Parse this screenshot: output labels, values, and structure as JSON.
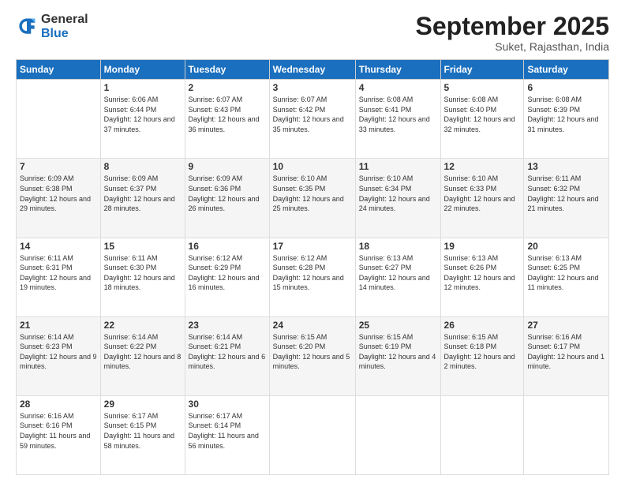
{
  "logo": {
    "general": "General",
    "blue": "Blue"
  },
  "title": "September 2025",
  "subtitle": "Suket, Rajasthan, India",
  "weekdays": [
    "Sunday",
    "Monday",
    "Tuesday",
    "Wednesday",
    "Thursday",
    "Friday",
    "Saturday"
  ],
  "rows": [
    [
      {
        "day": "",
        "sunrise": "",
        "sunset": "",
        "daylight": ""
      },
      {
        "day": "1",
        "sunrise": "Sunrise: 6:06 AM",
        "sunset": "Sunset: 6:44 PM",
        "daylight": "Daylight: 12 hours and 37 minutes."
      },
      {
        "day": "2",
        "sunrise": "Sunrise: 6:07 AM",
        "sunset": "Sunset: 6:43 PM",
        "daylight": "Daylight: 12 hours and 36 minutes."
      },
      {
        "day": "3",
        "sunrise": "Sunrise: 6:07 AM",
        "sunset": "Sunset: 6:42 PM",
        "daylight": "Daylight: 12 hours and 35 minutes."
      },
      {
        "day": "4",
        "sunrise": "Sunrise: 6:08 AM",
        "sunset": "Sunset: 6:41 PM",
        "daylight": "Daylight: 12 hours and 33 minutes."
      },
      {
        "day": "5",
        "sunrise": "Sunrise: 6:08 AM",
        "sunset": "Sunset: 6:40 PM",
        "daylight": "Daylight: 12 hours and 32 minutes."
      },
      {
        "day": "6",
        "sunrise": "Sunrise: 6:08 AM",
        "sunset": "Sunset: 6:39 PM",
        "daylight": "Daylight: 12 hours and 31 minutes."
      }
    ],
    [
      {
        "day": "7",
        "sunrise": "Sunrise: 6:09 AM",
        "sunset": "Sunset: 6:38 PM",
        "daylight": "Daylight: 12 hours and 29 minutes."
      },
      {
        "day": "8",
        "sunrise": "Sunrise: 6:09 AM",
        "sunset": "Sunset: 6:37 PM",
        "daylight": "Daylight: 12 hours and 28 minutes."
      },
      {
        "day": "9",
        "sunrise": "Sunrise: 6:09 AM",
        "sunset": "Sunset: 6:36 PM",
        "daylight": "Daylight: 12 hours and 26 minutes."
      },
      {
        "day": "10",
        "sunrise": "Sunrise: 6:10 AM",
        "sunset": "Sunset: 6:35 PM",
        "daylight": "Daylight: 12 hours and 25 minutes."
      },
      {
        "day": "11",
        "sunrise": "Sunrise: 6:10 AM",
        "sunset": "Sunset: 6:34 PM",
        "daylight": "Daylight: 12 hours and 24 minutes."
      },
      {
        "day": "12",
        "sunrise": "Sunrise: 6:10 AM",
        "sunset": "Sunset: 6:33 PM",
        "daylight": "Daylight: 12 hours and 22 minutes."
      },
      {
        "day": "13",
        "sunrise": "Sunrise: 6:11 AM",
        "sunset": "Sunset: 6:32 PM",
        "daylight": "Daylight: 12 hours and 21 minutes."
      }
    ],
    [
      {
        "day": "14",
        "sunrise": "Sunrise: 6:11 AM",
        "sunset": "Sunset: 6:31 PM",
        "daylight": "Daylight: 12 hours and 19 minutes."
      },
      {
        "day": "15",
        "sunrise": "Sunrise: 6:11 AM",
        "sunset": "Sunset: 6:30 PM",
        "daylight": "Daylight: 12 hours and 18 minutes."
      },
      {
        "day": "16",
        "sunrise": "Sunrise: 6:12 AM",
        "sunset": "Sunset: 6:29 PM",
        "daylight": "Daylight: 12 hours and 16 minutes."
      },
      {
        "day": "17",
        "sunrise": "Sunrise: 6:12 AM",
        "sunset": "Sunset: 6:28 PM",
        "daylight": "Daylight: 12 hours and 15 minutes."
      },
      {
        "day": "18",
        "sunrise": "Sunrise: 6:13 AM",
        "sunset": "Sunset: 6:27 PM",
        "daylight": "Daylight: 12 hours and 14 minutes."
      },
      {
        "day": "19",
        "sunrise": "Sunrise: 6:13 AM",
        "sunset": "Sunset: 6:26 PM",
        "daylight": "Daylight: 12 hours and 12 minutes."
      },
      {
        "day": "20",
        "sunrise": "Sunrise: 6:13 AM",
        "sunset": "Sunset: 6:25 PM",
        "daylight": "Daylight: 12 hours and 11 minutes."
      }
    ],
    [
      {
        "day": "21",
        "sunrise": "Sunrise: 6:14 AM",
        "sunset": "Sunset: 6:23 PM",
        "daylight": "Daylight: 12 hours and 9 minutes."
      },
      {
        "day": "22",
        "sunrise": "Sunrise: 6:14 AM",
        "sunset": "Sunset: 6:22 PM",
        "daylight": "Daylight: 12 hours and 8 minutes."
      },
      {
        "day": "23",
        "sunrise": "Sunrise: 6:14 AM",
        "sunset": "Sunset: 6:21 PM",
        "daylight": "Daylight: 12 hours and 6 minutes."
      },
      {
        "day": "24",
        "sunrise": "Sunrise: 6:15 AM",
        "sunset": "Sunset: 6:20 PM",
        "daylight": "Daylight: 12 hours and 5 minutes."
      },
      {
        "day": "25",
        "sunrise": "Sunrise: 6:15 AM",
        "sunset": "Sunset: 6:19 PM",
        "daylight": "Daylight: 12 hours and 4 minutes."
      },
      {
        "day": "26",
        "sunrise": "Sunrise: 6:15 AM",
        "sunset": "Sunset: 6:18 PM",
        "daylight": "Daylight: 12 hours and 2 minutes."
      },
      {
        "day": "27",
        "sunrise": "Sunrise: 6:16 AM",
        "sunset": "Sunset: 6:17 PM",
        "daylight": "Daylight: 12 hours and 1 minute."
      }
    ],
    [
      {
        "day": "28",
        "sunrise": "Sunrise: 6:16 AM",
        "sunset": "Sunset: 6:16 PM",
        "daylight": "Daylight: 11 hours and 59 minutes."
      },
      {
        "day": "29",
        "sunrise": "Sunrise: 6:17 AM",
        "sunset": "Sunset: 6:15 PM",
        "daylight": "Daylight: 11 hours and 58 minutes."
      },
      {
        "day": "30",
        "sunrise": "Sunrise: 6:17 AM",
        "sunset": "Sunset: 6:14 PM",
        "daylight": "Daylight: 11 hours and 56 minutes."
      },
      {
        "day": "",
        "sunrise": "",
        "sunset": "",
        "daylight": ""
      },
      {
        "day": "",
        "sunrise": "",
        "sunset": "",
        "daylight": ""
      },
      {
        "day": "",
        "sunrise": "",
        "sunset": "",
        "daylight": ""
      },
      {
        "day": "",
        "sunrise": "",
        "sunset": "",
        "daylight": ""
      }
    ]
  ]
}
